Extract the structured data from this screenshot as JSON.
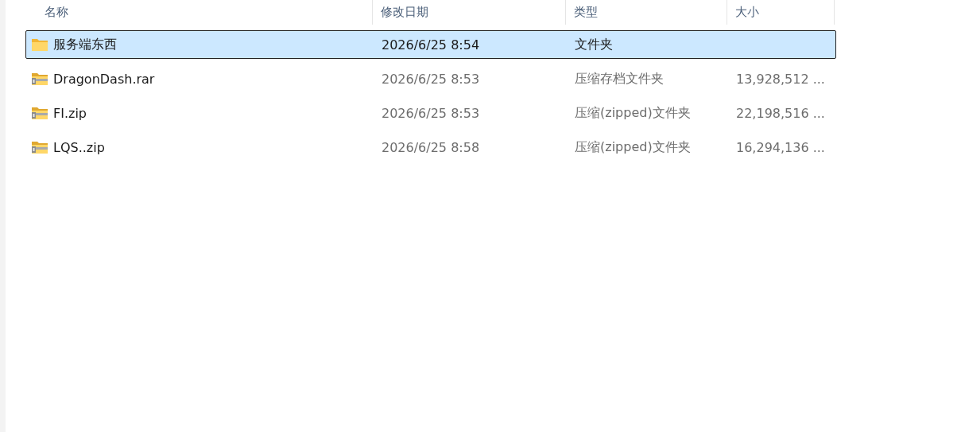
{
  "columns": [
    "名称",
    "修改日期",
    "类型",
    "大小"
  ],
  "rows": [
    {
      "kind": "folder",
      "name": "服务端东西",
      "modified": "2026/6/25 8:54",
      "type": "文件夹",
      "selected": true
    },
    {
      "kind": "archive",
      "name": "DragonDash.rar",
      "modified": "2026/6/25 8:53",
      "type": "压缩存档文件夹",
      "size": "13,928,512 ...",
      "selected": false
    },
    {
      "kind": "archive",
      "name": "FI.zip",
      "modified": "2026/6/25 8:53",
      "type": "压缩(zipped)文件夹",
      "size": "22,198,516 ...",
      "selected": false
    },
    {
      "kind": "archive",
      "name": "LQS..zip",
      "modified": "2026/6/25 8:58",
      "type": "压缩(zipped)文件夹",
      "size": "16,294,136 ...",
      "selected": false
    }
  ]
}
